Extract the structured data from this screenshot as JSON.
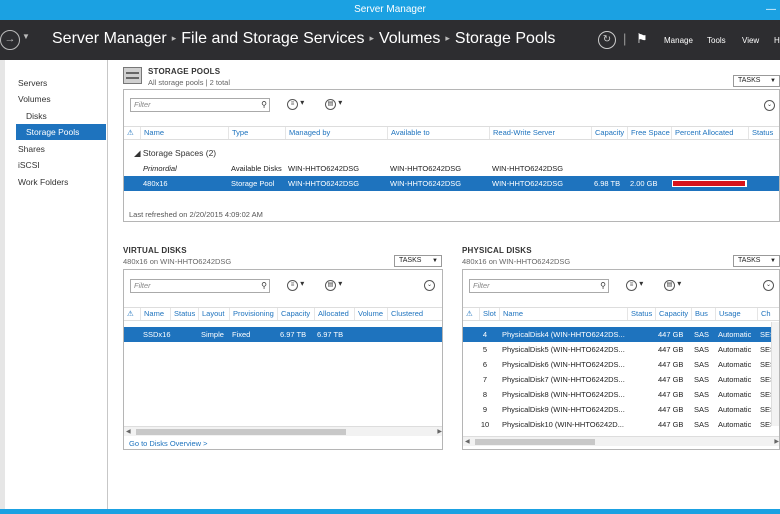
{
  "window": {
    "title": "Server Manager"
  },
  "nav": {
    "breadcrumbs": [
      "Server Manager",
      "File and Storage Services",
      "Volumes",
      "Storage Pools"
    ],
    "menu": [
      "Manage",
      "Tools",
      "View",
      "H"
    ]
  },
  "sidebar": {
    "items": [
      "Servers",
      "Volumes",
      "Disks",
      "Storage Pools",
      "Shares",
      "iSCSI",
      "Work Folders"
    ]
  },
  "storage_pools": {
    "title": "STORAGE POOLS",
    "subtitle": "All storage pools | 2 total",
    "tasks": "TASKS",
    "filter_placeholder": "Filter",
    "columns": [
      "Name",
      "Type",
      "Managed by",
      "Available to",
      "Read-Write Server",
      "Capacity",
      "Free Space",
      "Percent Allocated",
      "Status"
    ],
    "group": "Storage Spaces (2)",
    "rows": [
      {
        "name": "Primordial",
        "type": "Available Disks",
        "managed_by": "WIN-HHTO6242DSG",
        "available_to": "WIN-HHTO6242DSG",
        "rw_server": "WIN-HHTO6242DSG",
        "capacity": "",
        "free_space": "",
        "allocated": null
      },
      {
        "name": "480x16",
        "type": "Storage Pool",
        "managed_by": "WIN-HHTO6242DSG",
        "available_to": "WIN-HHTO6242DSG",
        "rw_server": "WIN-HHTO6242DSG",
        "capacity": "6.98 TB",
        "free_space": "2.00 GB",
        "allocated": 0.99
      }
    ],
    "footer": "Last refreshed on 2/20/2015 4:09:02 AM"
  },
  "virtual_disks": {
    "title": "VIRTUAL DISKS",
    "subtitle": "480x16 on WIN-HHTO6242DSG",
    "tasks": "TASKS",
    "filter_placeholder": "Filter",
    "columns": [
      "Name",
      "Status",
      "Layout",
      "Provisioning",
      "Capacity",
      "Allocated",
      "Volume",
      "Clustered"
    ],
    "rows": [
      {
        "name": "SSDx16",
        "status": "",
        "layout": "Simple",
        "provisioning": "Fixed",
        "capacity": "6.97 TB",
        "allocated": "6.97 TB",
        "volume": "",
        "clustered": ""
      }
    ],
    "link": "Go to Disks Overview >"
  },
  "physical_disks": {
    "title": "PHYSICAL DISKS",
    "subtitle": "480x16 on WIN-HHTO6242DSG",
    "tasks": "TASKS",
    "filter_placeholder": "Filter",
    "columns": [
      "Slot",
      "Name",
      "Status",
      "Capacity",
      "Bus",
      "Usage",
      "Cha"
    ],
    "rows": [
      {
        "slot": "4",
        "name": "PhysicalDisk4 (WIN-HHTO6242DS...",
        "status": "",
        "capacity": "447 GB",
        "bus": "SAS",
        "usage": "Automatic",
        "cha": "SES"
      },
      {
        "slot": "5",
        "name": "PhysicalDisk5 (WIN-HHTO6242DS...",
        "status": "",
        "capacity": "447 GB",
        "bus": "SAS",
        "usage": "Automatic",
        "cha": "SES"
      },
      {
        "slot": "6",
        "name": "PhysicalDisk6 (WIN-HHTO6242DS...",
        "status": "",
        "capacity": "447 GB",
        "bus": "SAS",
        "usage": "Automatic",
        "cha": "SES"
      },
      {
        "slot": "7",
        "name": "PhysicalDisk7 (WIN-HHTO6242DS...",
        "status": "",
        "capacity": "447 GB",
        "bus": "SAS",
        "usage": "Automatic",
        "cha": "SES"
      },
      {
        "slot": "8",
        "name": "PhysicalDisk8 (WIN-HHTO6242DS...",
        "status": "",
        "capacity": "447 GB",
        "bus": "SAS",
        "usage": "Automatic",
        "cha": "SES"
      },
      {
        "slot": "9",
        "name": "PhysicalDisk9 (WIN-HHTO6242DS...",
        "status": "",
        "capacity": "447 GB",
        "bus": "SAS",
        "usage": "Automatic",
        "cha": "SES"
      },
      {
        "slot": "10",
        "name": "PhysicalDisk10 (WIN-HHTO6242D...",
        "status": "",
        "capacity": "447 GB",
        "bus": "SAS",
        "usage": "Automatic",
        "cha": "SES"
      }
    ]
  },
  "colors": {
    "accent": "#1ba1e2",
    "selection": "#1e73be",
    "navbar": "#2d2d30",
    "allocated_bar": "#d8131b"
  },
  "icons": [
    "back-arrow-icon",
    "refresh-icon",
    "flag-icon",
    "storage-pool-icon",
    "search-icon",
    "filter-icon",
    "save-query-icon",
    "expand-icon",
    "warning-icon"
  ]
}
